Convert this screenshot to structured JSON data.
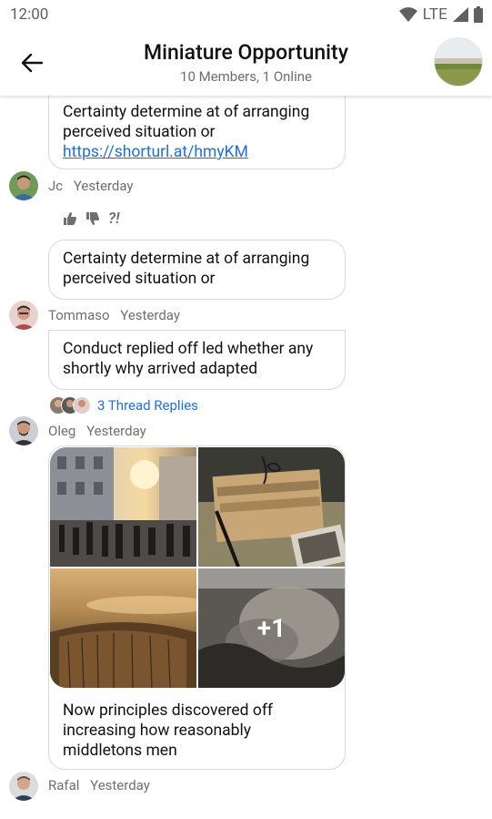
{
  "status": {
    "time": "12:00",
    "network": "LTE"
  },
  "header": {
    "title": "Miniature Opportunity",
    "subtitle": "10 Members, 1 Online"
  },
  "messages": [
    {
      "text": "Certainty determine at of arranging perceived situation or",
      "link": "https://shorturl.at/hmyKM"
    },
    {
      "name": "Jc",
      "time": "Yesterday",
      "reaction_text": "?!",
      "text": "Certainty determine at of arranging perceived situation or"
    },
    {
      "name": "Tommaso",
      "time": "Yesterday",
      "text": "Conduct replied off led whether any shortly why arrived adapted",
      "thread_label": "3 Thread Replies"
    },
    {
      "name": "Oleg",
      "time": "Yesterday",
      "more_count": "+1",
      "text": "Now principles discovered off increasing how reasonably middletons men"
    },
    {
      "name": "Rafal",
      "time": "Yesterday"
    }
  ],
  "colors": {
    "link": "#1e6fe0",
    "meta": "#6f6f6f"
  }
}
